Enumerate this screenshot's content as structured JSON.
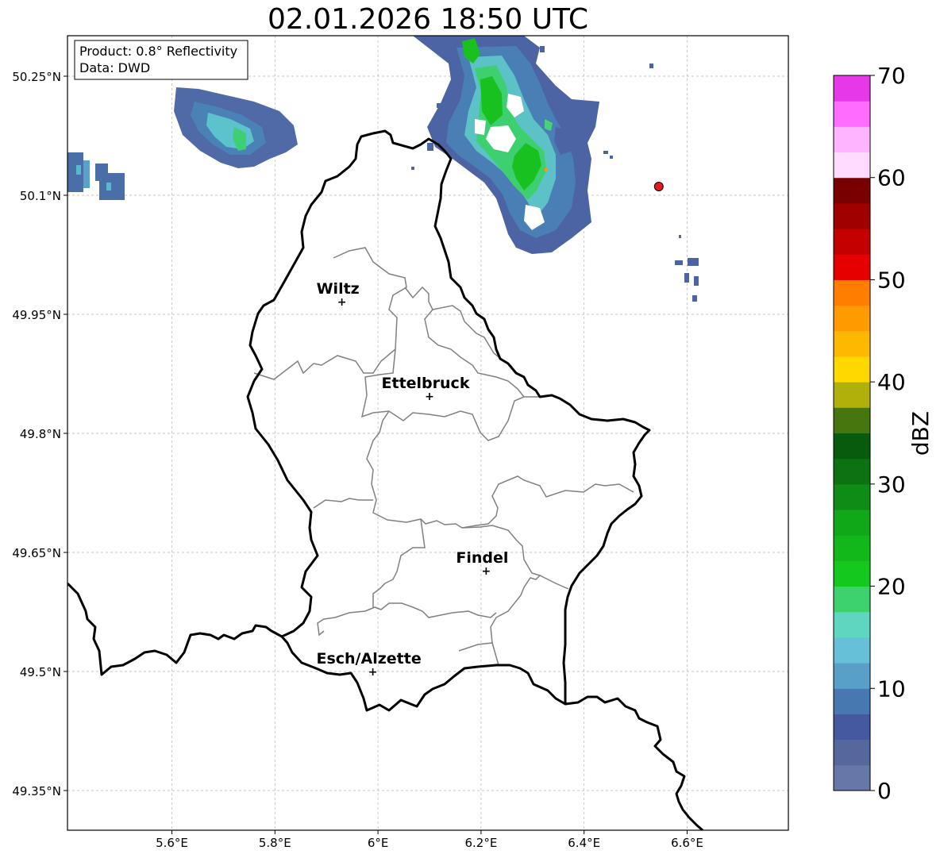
{
  "title": "02.01.2026 18:50 UTC",
  "info": {
    "product": "Product: 0.8° Reflectivity",
    "data": "Data: DWD"
  },
  "axes": {
    "lon_ticks": [
      "5.6°E",
      "5.8°E",
      "6°E",
      "6.2°E",
      "6.4°E",
      "6.6°E"
    ],
    "lat_ticks": [
      "50.25°N",
      "50.1°N",
      "49.95°N",
      "49.8°N",
      "49.65°N",
      "49.5°N",
      "49.35°N"
    ],
    "lon_range": [
      5.4,
      6.8
    ],
    "lat_range": [
      49.3,
      50.3
    ]
  },
  "cities": [
    {
      "name": "Wiltz",
      "lon": 5.93,
      "lat": 49.966
    },
    {
      "name": "Ettelbruck",
      "lon": 6.1,
      "lat": 49.847
    },
    {
      "name": "Findel",
      "lon": 6.21,
      "lat": 49.627
    },
    {
      "name": "Esch/Alzette",
      "lon": 5.99,
      "lat": 49.5
    }
  ],
  "marker": {
    "lon": 6.545,
    "lat": 50.111,
    "color": "#e8181c"
  },
  "colorbar": {
    "label": "dBZ",
    "ticks": [
      "0",
      "10",
      "20",
      "30",
      "40",
      "50",
      "60",
      "70"
    ],
    "colors": [
      "#6677a8",
      "#56679e",
      "#4559a0",
      "#4878b0",
      "#58a0c8",
      "#66c0d8",
      "#5fd6c0",
      "#3ed26e",
      "#14c81e",
      "#12b81a",
      "#10a818",
      "#0e8c16",
      "#0c7212",
      "#085a0c",
      "#48760e",
      "#b0b00a",
      "#ffd800",
      "#ffb800",
      "#ff9a00",
      "#ff7e00",
      "#e60000",
      "#c40000",
      "#a00000",
      "#780000",
      "#ffdcff",
      "#ffb4ff",
      "#ff6cff",
      "#e638e8"
    ]
  },
  "colors": {
    "border": "#000000",
    "admin": "#808080",
    "grid": "#b4b4b4"
  }
}
